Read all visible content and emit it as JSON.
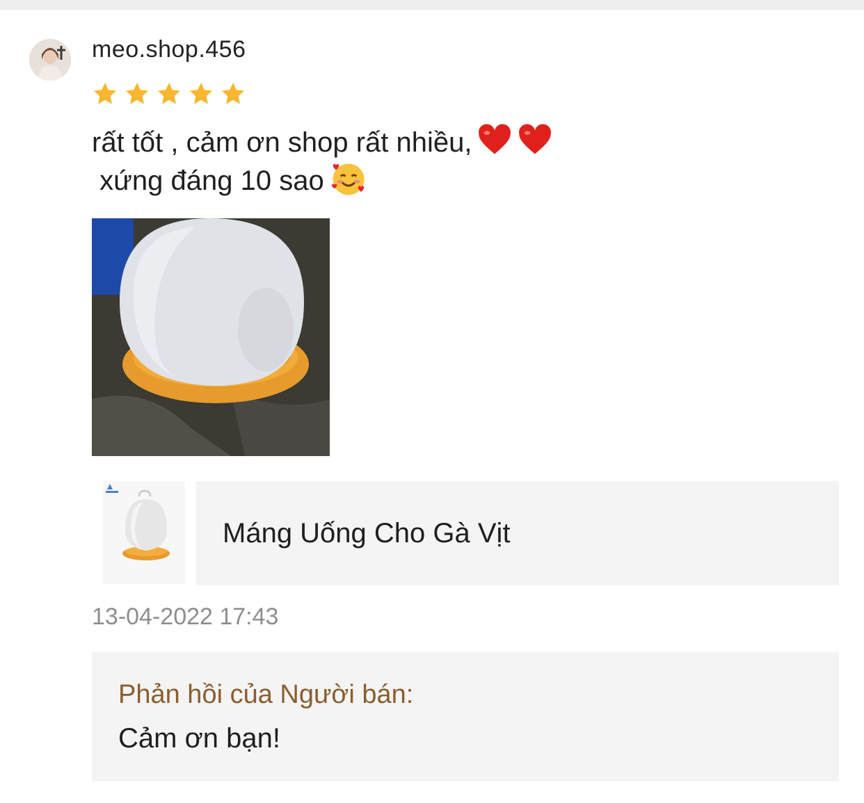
{
  "review": {
    "username": "meo.shop.456",
    "rating": 5,
    "rating_max": 5,
    "comment_line1": "rất tốt , cảm ơn shop rất nhiều,",
    "comment_line2": " xứng đáng 10 sao",
    "timestamp": "13-04-2022 17:43"
  },
  "product": {
    "name": "Máng Uống Cho Gà Vịt"
  },
  "seller_reply": {
    "title": "Phản hồi của Người bán:",
    "text": "Cảm ơn bạn!"
  },
  "colors": {
    "star": "#f7b731",
    "reply_title": "#8b5e2e",
    "timestamp": "#8e8e8e"
  }
}
